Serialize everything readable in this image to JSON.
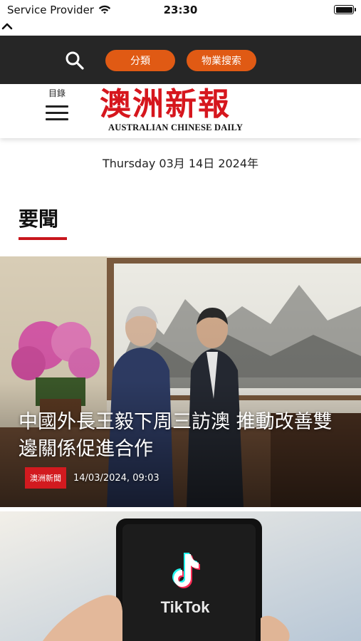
{
  "status_bar": {
    "carrier": "Service Provider",
    "time": "23:30",
    "battery_level": 1.0
  },
  "toolbar": {
    "category_label": "分類",
    "property_search_label": "物業搜索"
  },
  "header": {
    "menu_label": "目錄",
    "logo_chinese": "澳洲新報",
    "logo_english": "AUSTRALIAN CHINESE DAILY"
  },
  "date_line": "Thursday 03月 14日 2024年",
  "section": {
    "title": "要聞"
  },
  "articles": [
    {
      "headline": "中國外長王毅下周三訪澳 推動改善雙邊關係促進合作",
      "category": "澳洲新聞",
      "datetime": "14/03/2024, 09:03"
    },
    {
      "image_text": "TikTok"
    }
  ],
  "colors": {
    "accent_orange": "#e05a14",
    "brand_red": "#d6161d",
    "toolbar_bg": "#262626"
  }
}
